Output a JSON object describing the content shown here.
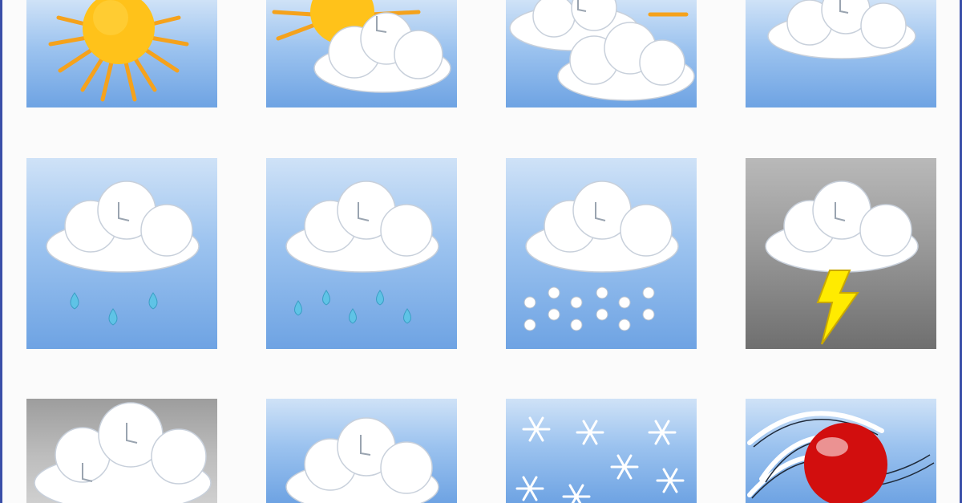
{
  "icons": [
    {
      "row": 1,
      "col": 1,
      "name": "sunny-icon"
    },
    {
      "row": 1,
      "col": 2,
      "name": "partly-cloudy-icon"
    },
    {
      "row": 1,
      "col": 3,
      "name": "mostly-cloudy-icon"
    },
    {
      "row": 1,
      "col": 4,
      "name": "cloudy-icon"
    },
    {
      "row": 2,
      "col": 1,
      "name": "light-rain-icon"
    },
    {
      "row": 2,
      "col": 2,
      "name": "rain-icon"
    },
    {
      "row": 2,
      "col": 3,
      "name": "hail-icon"
    },
    {
      "row": 2,
      "col": 4,
      "name": "thunderstorm-icon"
    },
    {
      "row": 3,
      "col": 1,
      "name": "overcast-icon"
    },
    {
      "row": 3,
      "col": 2,
      "name": "cloud-icon"
    },
    {
      "row": 3,
      "col": 3,
      "name": "snowflakes-icon"
    },
    {
      "row": 3,
      "col": 4,
      "name": "wind-icon"
    }
  ],
  "colors": {
    "sky_top": "#cfe2f7",
    "sky_bottom": "#6ea3e3",
    "sun": "#ffc21a",
    "sun_ray": "#f5a21c",
    "cloud": "#ffffff",
    "raindrop": "#5fc3e6",
    "lightning": "#ffeb00",
    "ball": "#d20e0e",
    "frame": "#3a4fa8"
  }
}
